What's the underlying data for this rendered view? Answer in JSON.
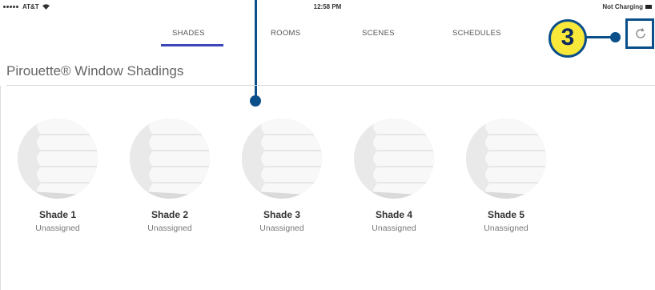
{
  "status_bar": {
    "carrier": "AT&T",
    "time": "12:58 PM",
    "battery_text": "Not Charging"
  },
  "tabs": [
    {
      "label": "SHADES",
      "active": true
    },
    {
      "label": "ROOMS",
      "active": false
    },
    {
      "label": "SCENES",
      "active": false
    },
    {
      "label": "SCHEDULES",
      "active": false
    }
  ],
  "page_title": "Pirouette® Window Shadings",
  "callout": {
    "number": "3"
  },
  "shades": [
    {
      "name": "Shade 1",
      "status": "Unassigned"
    },
    {
      "name": "Shade 2",
      "status": "Unassigned"
    },
    {
      "name": "Shade 3",
      "status": "Unassigned"
    },
    {
      "name": "Shade 4",
      "status": "Unassigned"
    },
    {
      "name": "Shade 5",
      "status": "Unassigned"
    }
  ],
  "colors": {
    "accent_tab": "#3c46b8",
    "callout_fill": "#f7e83a",
    "callout_stroke": "#0b4f8a"
  },
  "icons": {
    "refresh": "refresh-icon",
    "wifi": "wifi-icon",
    "battery": "battery-icon"
  }
}
